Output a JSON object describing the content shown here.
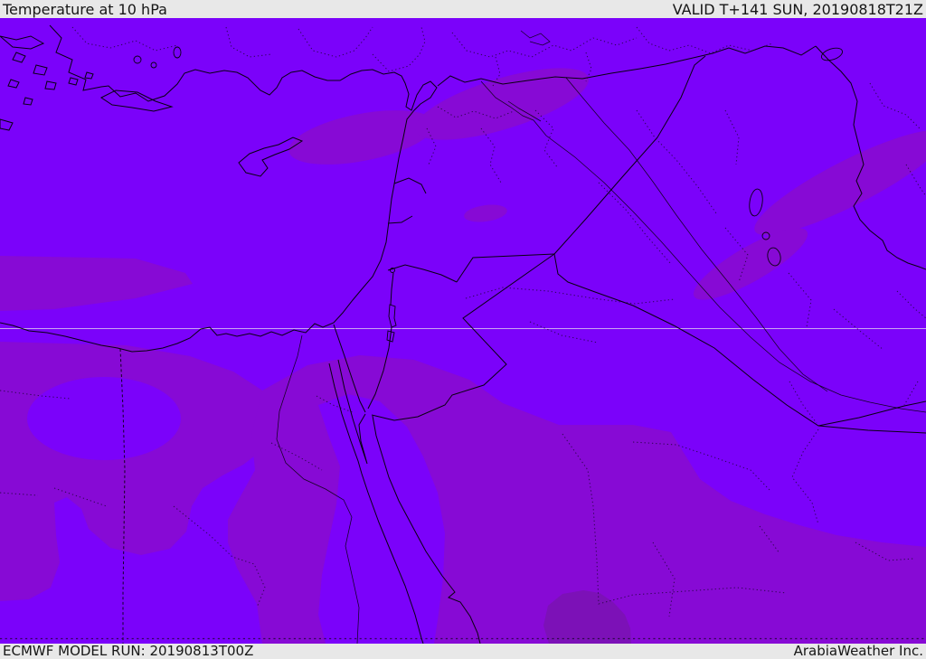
{
  "header": {
    "title": "Temperature at 10 hPa",
    "valid_time": "VALID T+141 SUN, 20190818T21Z"
  },
  "footer": {
    "model_run": "ECMWF MODEL RUN: 20190813T00Z",
    "credit": "ArabiaWeather Inc."
  },
  "colors": {
    "panel_bg": "#e8e8e8",
    "panel_text": "#161616",
    "temp_base": "#7b02fa",
    "temp_mid": "#870ad5",
    "temp_dark": "#7c11b7",
    "line_black": "#000000",
    "graticule": "#d9c2ee"
  }
}
